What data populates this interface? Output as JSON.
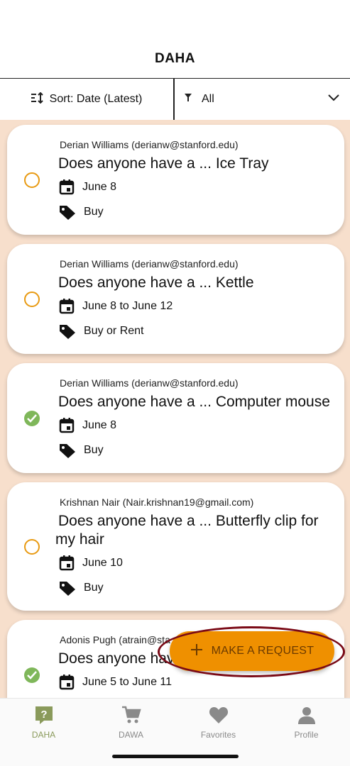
{
  "header": {
    "title": "DAHA"
  },
  "toolbar": {
    "sort_label": "Sort: Date (Latest)",
    "filter_label": "All"
  },
  "requests": [
    {
      "requester": "Derian Williams (derianw@stanford.edu)",
      "title": "Does anyone have a ... Ice Tray",
      "dates": "June 8",
      "type": "Buy",
      "fulfilled": false
    },
    {
      "requester": "Derian Williams (derianw@stanford.edu)",
      "title": "Does anyone have a ... Kettle",
      "dates": "June 8 to June 12",
      "type": "Buy or Rent",
      "fulfilled": false
    },
    {
      "requester": "Derian Williams (derianw@stanford.edu)",
      "title": "Does anyone have a ... Computer mouse",
      "dates": "June 8",
      "type": "Buy",
      "fulfilled": true
    },
    {
      "requester": "Krishnan Nair (Nair.krishnan19@gmail.com)",
      "title": "Does anyone have a ... Butterfly clip for my hair",
      "dates": "June 10",
      "type": "Buy",
      "fulfilled": false
    },
    {
      "requester": "Adonis Pugh (atrain@sta",
      "title": "Does anyone have",
      "dates": "June 5 to June 11",
      "fulfilled": true
    }
  ],
  "fab": {
    "label": "MAKE A REQUEST"
  },
  "tabs": [
    {
      "label": "DAHA",
      "icon": "question-bubble-icon",
      "active": true
    },
    {
      "label": "DAWA",
      "icon": "cart-icon",
      "active": false
    },
    {
      "label": "Favorites",
      "icon": "heart-icon",
      "active": false
    },
    {
      "label": "Profile",
      "icon": "person-icon",
      "active": false
    }
  ],
  "colors": {
    "list_background": "#f7dfcc",
    "accent_orange": "#ef9000",
    "fulfilled_green": "#7fb75a",
    "active_tab": "#8a9a5b",
    "highlight_ring": "#7a0a16"
  }
}
